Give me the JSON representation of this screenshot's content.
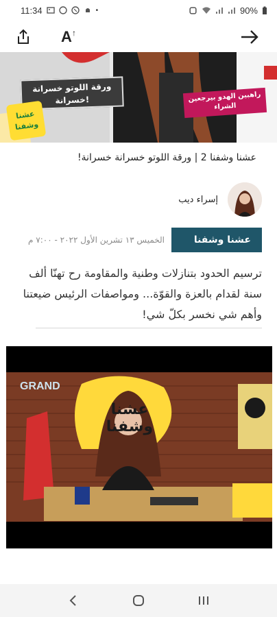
{
  "status_bar": {
    "time": "11:34",
    "battery": "90%",
    "dot": "•"
  },
  "toolbar": {
    "font_size_label": "A",
    "font_size_sup": "↑"
  },
  "hero": {
    "caption": "ورقة اللوتو خسرانة خسرانة!",
    "pink_tag": "راهبين الهدو بيرجعين الشراء",
    "logo_text": "عشنا وشفنا"
  },
  "article": {
    "headline": "عشنا وشفنا 2 | ورقة اللوتو خسرانة خسرانة!",
    "author_name": "إسراء ديب",
    "category": "عشنا وشفنا",
    "date": "الخميس ١٣ تشرين الأول ٢٠٢٢ - ٧:٠٠ م",
    "lead": "ترسيم الحدود بتنازلات وطنية والمقاومة رح تهنّا ألف سنة لقدام بالعزة والقوّة... ومواصفات الرئيس ضيعتنا وأهم شي نخسر بكلّ شي!"
  },
  "video": {
    "channel_logo": "GRAND",
    "show_title": "عشنا وشفنا"
  },
  "colors": {
    "category_bg": "#1f5669",
    "hero_pink": "#c2185b"
  },
  "icons": {
    "share": "share-icon",
    "font_size": "font-size-icon",
    "back": "arrow-right-icon",
    "nav_back": "chevron-left-icon",
    "nav_home": "home-circle-icon",
    "nav_recents": "recents-icon"
  }
}
